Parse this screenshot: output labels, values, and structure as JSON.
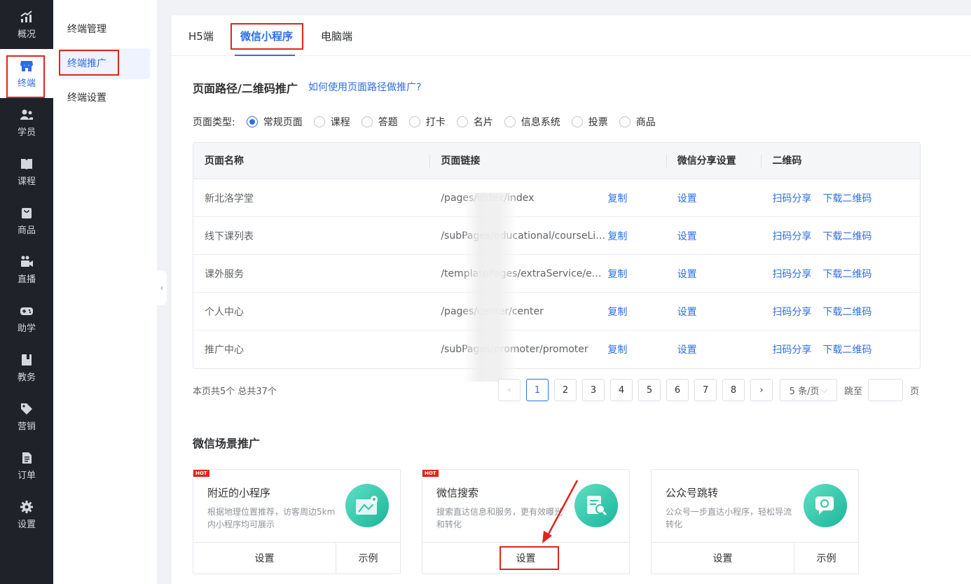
{
  "nav": [
    {
      "label": "概况",
      "icon": "chart-trend-icon"
    },
    {
      "label": "终端",
      "icon": "storefront-icon"
    },
    {
      "label": "学员",
      "icon": "users-icon"
    },
    {
      "label": "课程",
      "icon": "book-icon"
    },
    {
      "label": "商品",
      "icon": "bag-icon"
    },
    {
      "label": "直播",
      "icon": "video-camera-icon"
    },
    {
      "label": "助学",
      "icon": "gamepad-icon"
    },
    {
      "label": "教务",
      "icon": "notebook-icon"
    },
    {
      "label": "营销",
      "icon": "tag-icon"
    },
    {
      "label": "订单",
      "icon": "document-icon"
    },
    {
      "label": "设置",
      "icon": "gear-icon"
    }
  ],
  "submenu": [
    "终端管理",
    "终端推广",
    "终端设置"
  ],
  "tabs": [
    "H5端",
    "微信小程序",
    "电脑端"
  ],
  "section1": {
    "title": "页面路径/二维码推广",
    "help": "如何使用页面路径做推广?",
    "filter_label": "页面类型:",
    "options": [
      "常规页面",
      "课程",
      "答题",
      "打卡",
      "名片",
      "信息系统",
      "投票",
      "商品"
    ]
  },
  "table": {
    "headers": [
      "页面名称",
      "页面链接",
      "微信分享设置",
      "二维码"
    ],
    "copy": "复制",
    "setting": "设置",
    "scan": "扫码分享",
    "download": "下载二维码",
    "rows": [
      {
        "name": "新北洛学堂",
        "url": "/pages/index/index"
      },
      {
        "name": "线下课列表",
        "url": "/subPages/educational/courseList/courseList"
      },
      {
        "name": "课外服务",
        "url": "/templatePages/extraService/extraService"
      },
      {
        "name": "个人中心",
        "url": "/pages/center/center"
      },
      {
        "name": "推广中心",
        "url": "/subPages/promoter/promoter"
      }
    ]
  },
  "pagination": {
    "summary": "本页共5个 总共37个",
    "pages": [
      "1",
      "2",
      "3",
      "4",
      "5",
      "6",
      "7",
      "8"
    ],
    "current": "1",
    "page_size": "5 条/页",
    "jump_label": "跳至",
    "page_unit": "页"
  },
  "section2": {
    "title": "微信场景推广",
    "cards": [
      {
        "hot": "HOT",
        "title": "附近的小程序",
        "desc": "根据地理位置推荐，访客周边5km内小程序均可展示",
        "setting": "设置",
        "example": "示例",
        "icon": "map-location-icon"
      },
      {
        "hot": "HOT",
        "title": "微信搜索",
        "desc": "搜索直达信息和服务，更有效曝光和转化",
        "setting": "设置",
        "icon": "document-search-icon"
      },
      {
        "title": "公众号跳转",
        "desc": "公众号一步直达小程序，轻松导流转化",
        "setting": "设置",
        "example": "示例",
        "icon": "mini-program-chat-icon"
      }
    ]
  },
  "colors": {
    "accent": "#2d6ee8",
    "nav_bg": "#1f2329",
    "highlight": "#e0251b",
    "icon_gradient": "#1bb59a"
  }
}
